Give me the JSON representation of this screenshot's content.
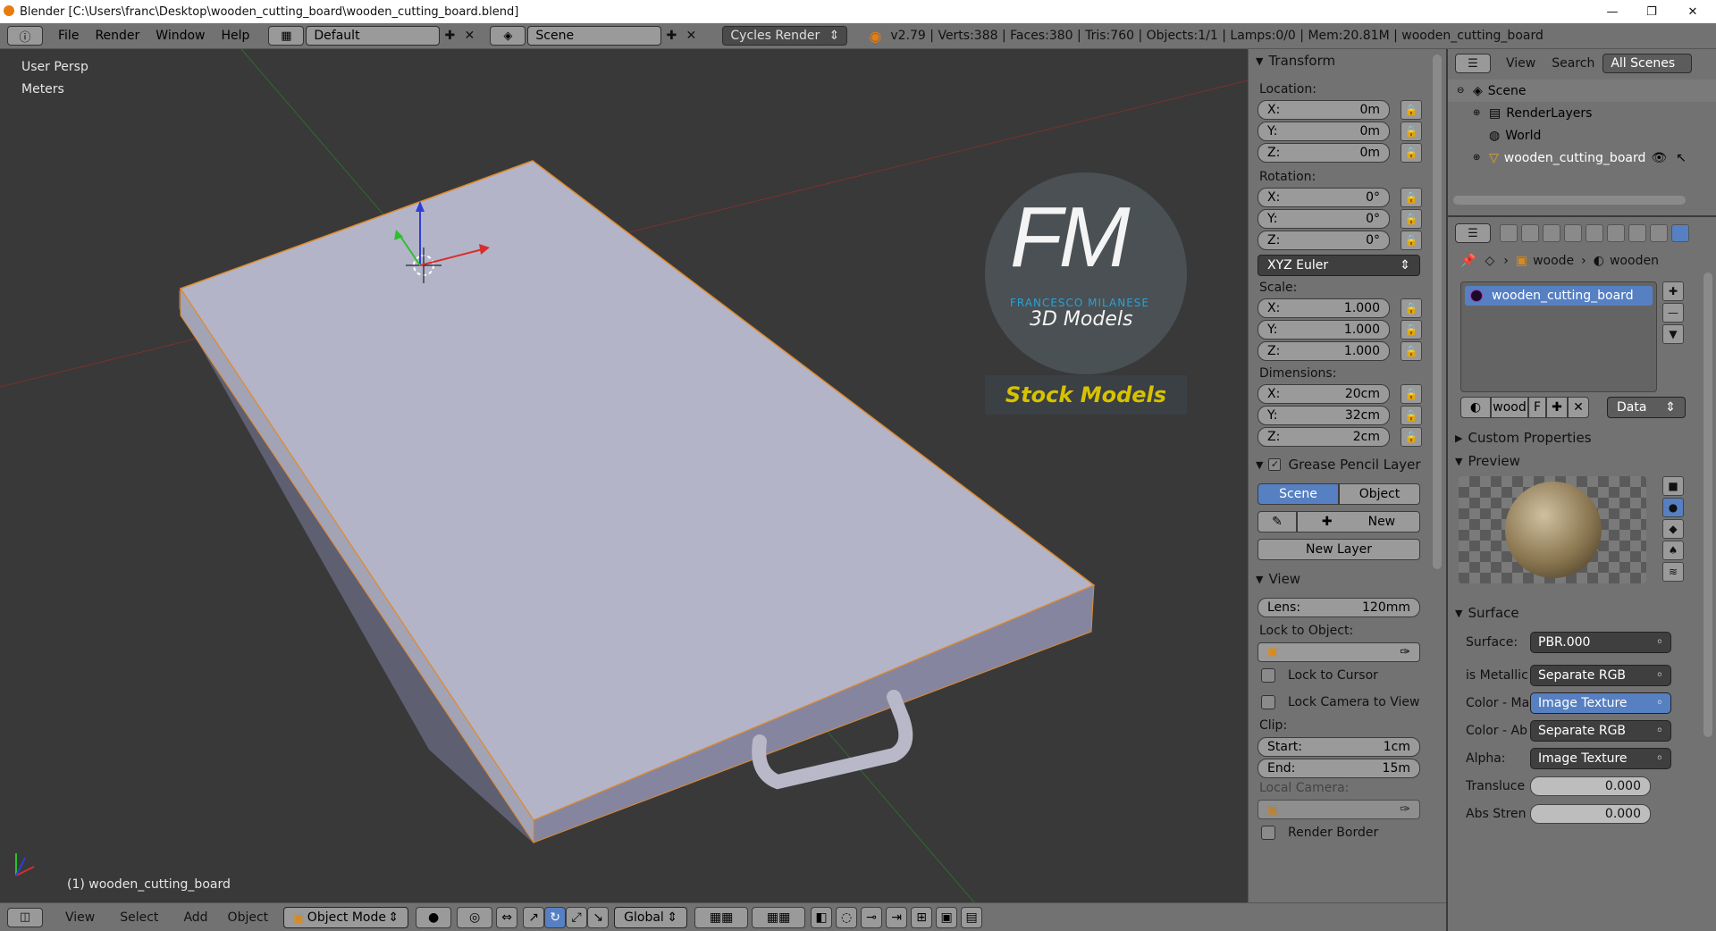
{
  "window": {
    "title": "Blender [C:\\Users\\franc\\Desktop\\wooden_cutting_board\\wooden_cutting_board.blend]"
  },
  "menubar": {
    "items": [
      "File",
      "Render",
      "Window",
      "Help"
    ],
    "layout": "Default",
    "scene": "Scene",
    "engine": "Cycles Render",
    "stats": "v2.79 | Verts:388 | Faces:380 | Tris:760 | Objects:1/1 | Lamps:0/0 | Mem:20.81M | wooden_cutting_board"
  },
  "viewport": {
    "view_name": "User Persp",
    "units": "Meters",
    "object_label": "(1) wooden_cutting_board"
  },
  "watermark": {
    "initials": "FM",
    "brand": "FRANCESCO MILANESE",
    "line1": "3D Models",
    "line2": "Stock Models"
  },
  "transform": {
    "title": "Transform",
    "location_label": "Location:",
    "location": [
      {
        "axis": "X:",
        "value": "0m"
      },
      {
        "axis": "Y:",
        "value": "0m"
      },
      {
        "axis": "Z:",
        "value": "0m"
      }
    ],
    "rotation_label": "Rotation:",
    "rotation": [
      {
        "axis": "X:",
        "value": "0°"
      },
      {
        "axis": "Y:",
        "value": "0°"
      },
      {
        "axis": "Z:",
        "value": "0°"
      }
    ],
    "rotation_mode": "XYZ Euler",
    "scale_label": "Scale:",
    "scale": [
      {
        "axis": "X:",
        "value": "1.000"
      },
      {
        "axis": "Y:",
        "value": "1.000"
      },
      {
        "axis": "Z:",
        "value": "1.000"
      }
    ],
    "dimensions_label": "Dimensions:",
    "dimensions": [
      {
        "axis": "X:",
        "value": "20cm"
      },
      {
        "axis": "Y:",
        "value": "32cm"
      },
      {
        "axis": "Z:",
        "value": "2cm"
      }
    ]
  },
  "grease": {
    "title": "Grease Pencil Layer",
    "tab_scene": "Scene",
    "tab_object": "Object",
    "new_label": "New",
    "new_layer_label": "New Layer"
  },
  "view": {
    "title": "View",
    "lens_label": "Lens:",
    "lens_value": "120mm",
    "lock_object_label": "Lock to Object:",
    "lock_cursor": "Lock to Cursor",
    "lock_camera": "Lock Camera to View",
    "clip_label": "Clip:",
    "start_label": "Start:",
    "start_value": "1cm",
    "end_label": "End:",
    "end_value": "15m",
    "local_camera": "Local Camera:",
    "render_border": "Render Border"
  },
  "outliner": {
    "view": "View",
    "search": "Search",
    "filter": "All Scenes",
    "items": [
      "Scene",
      "RenderLayers",
      "World",
      "wooden_cutting_board"
    ]
  },
  "properties": {
    "breadcrumb1": "woode",
    "breadcrumb2": "wooden",
    "material_slot": "wooden_cutting_board",
    "mat_name": "wood",
    "mat_f": "F",
    "link": "Data",
    "custom_props": "Custom Properties",
    "preview": "Preview",
    "surface_title": "Surface",
    "surface_label": "Surface:",
    "surface_value": "PBR.000",
    "rows": [
      {
        "label": "is Metallic",
        "value": "Separate RGB"
      },
      {
        "label": "Color - Ma",
        "value": "Image Texture"
      },
      {
        "label": "Color - Ab",
        "value": "Separate RGB"
      },
      {
        "label": "Alpha:",
        "value": "Image Texture"
      }
    ],
    "translucency_label": "Transluce",
    "translucency_value": "0.000",
    "abs_label": "Abs Stren",
    "abs_value": "0.000"
  },
  "bottombar": {
    "view": "View",
    "select": "Select",
    "add": "Add",
    "object": "Object",
    "mode": "Object Mode",
    "orientation": "Global"
  }
}
